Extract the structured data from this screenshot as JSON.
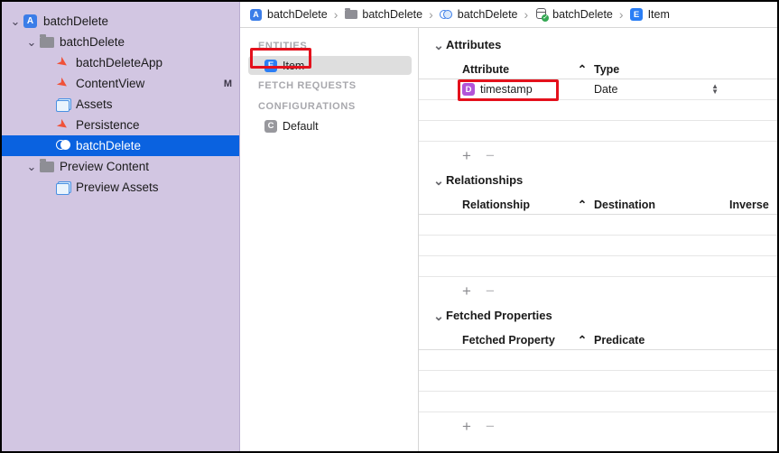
{
  "navigator": {
    "rows": [
      {
        "label": "batchDelete",
        "icon": "app-icon",
        "indent": 0,
        "twisty": "down",
        "status": "",
        "selected": false
      },
      {
        "label": "batchDelete",
        "icon": "folder-icon",
        "indent": 1,
        "twisty": "down",
        "status": "",
        "selected": false
      },
      {
        "label": "batchDeleteApp",
        "icon": "swift-file-icon",
        "indent": 2,
        "twisty": "",
        "status": "",
        "selected": false
      },
      {
        "label": "ContentView",
        "icon": "swift-file-icon",
        "indent": 2,
        "twisty": "",
        "status": "M",
        "selected": false
      },
      {
        "label": "Assets",
        "icon": "asset-catalog-icon",
        "indent": 2,
        "twisty": "",
        "status": "",
        "selected": false
      },
      {
        "label": "Persistence",
        "icon": "swift-file-icon",
        "indent": 2,
        "twisty": "",
        "status": "",
        "selected": false
      },
      {
        "label": "batchDelete",
        "icon": "coredata-model-icon",
        "indent": 2,
        "twisty": "",
        "status": "",
        "selected": true
      },
      {
        "label": "Preview Content",
        "icon": "folder-icon",
        "indent": 1,
        "twisty": "down",
        "status": "",
        "selected": false
      },
      {
        "label": "Preview Assets",
        "icon": "asset-catalog-icon",
        "indent": 2,
        "twisty": "",
        "status": "",
        "selected": false
      }
    ]
  },
  "breadcrumb": {
    "separator": "›",
    "items": [
      {
        "label": "batchDelete",
        "icon": "app-icon"
      },
      {
        "label": "batchDelete",
        "icon": "folder-icon"
      },
      {
        "label": "batchDelete",
        "icon": "coredata-model-icon"
      },
      {
        "label": "batchDelete",
        "icon": "persistent-store-icon"
      },
      {
        "label": "Item",
        "icon": "entity-icon"
      }
    ]
  },
  "entities_pane": {
    "sections": [
      {
        "header": "ENTITIES",
        "rows": [
          {
            "label": "Item",
            "icon": "entity-icon",
            "badge": "E",
            "selected": true
          }
        ]
      },
      {
        "header": "FETCH REQUESTS",
        "rows": []
      },
      {
        "header": "CONFIGURATIONS",
        "rows": [
          {
            "label": "Default",
            "icon": "configuration-icon",
            "badge": "C",
            "selected": false
          }
        ]
      }
    ]
  },
  "detail": {
    "sections": [
      {
        "title": "Attributes",
        "collapsed": false,
        "sort_caret": "⌃",
        "columns": [
          "Attribute",
          "Type"
        ],
        "rows": [
          {
            "name": "timestamp",
            "badge": "D",
            "type": "Date",
            "stepper": true
          }
        ],
        "empty_rows": 2,
        "add_label": "+",
        "remove_label": "−"
      },
      {
        "title": "Relationships",
        "collapsed": false,
        "sort_caret": "⌃",
        "columns": [
          "Relationship",
          "Destination",
          "Inverse"
        ],
        "rows": [],
        "empty_rows": 3,
        "add_label": "+",
        "remove_label": "−"
      },
      {
        "title": "Fetched Properties",
        "collapsed": false,
        "sort_caret": "⌃",
        "columns": [
          "Fetched Property",
          "Predicate"
        ],
        "rows": [],
        "empty_rows": 3,
        "add_label": "+",
        "remove_label": "−"
      }
    ]
  },
  "annotations": [
    {
      "name": "entity-item-highlight",
      "color": "#e4111c"
    },
    {
      "name": "attribute-row-highlight",
      "color": "#e4111c"
    }
  ],
  "colors": {
    "sidebar_bg": "#d2c6e2",
    "selection_blue": "#0a62e0",
    "entity_blue": "#2a7ef5",
    "attribute_purple": "#b254d8",
    "swift_orange": "#f05138",
    "annotation_red": "#e4111c"
  }
}
